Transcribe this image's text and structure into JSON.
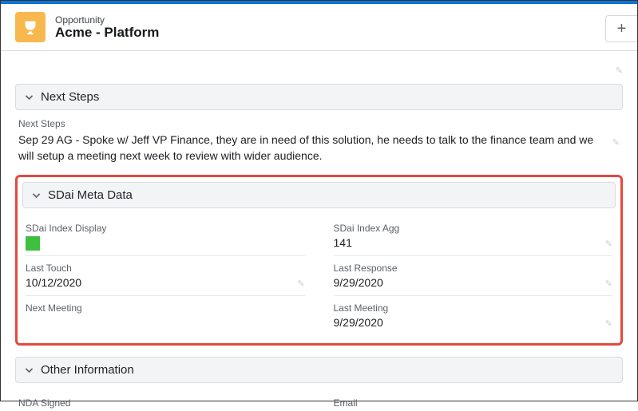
{
  "header": {
    "object_label": "Opportunity",
    "title": "Acme - Platform",
    "add_tooltip": "+"
  },
  "sections": {
    "next_steps": {
      "title": "Next Steps",
      "field_label": "Next Steps",
      "text": "Sep 29 AG - Spoke w/ Jeff VP Finance, they are in need of this solution, he needs to talk to the finance team and we will setup a meeting next week to review with wider audience."
    },
    "sdai": {
      "title": "SDai Meta Data",
      "fields": {
        "index_display": {
          "label": "SDai Index Display",
          "color": "#3fbf3f"
        },
        "index_agg": {
          "label": "SDai Index Agg",
          "value": "141"
        },
        "last_touch": {
          "label": "Last Touch",
          "value": "10/12/2020"
        },
        "last_response": {
          "label": "Last Response",
          "value": "9/29/2020"
        },
        "next_meeting": {
          "label": "Next Meeting",
          "value": ""
        },
        "last_meeting": {
          "label": "Last Meeting",
          "value": "9/29/2020"
        }
      }
    },
    "other": {
      "title": "Other Information",
      "fields": {
        "nda_signed": {
          "label": "NDA Signed"
        },
        "email": {
          "label": "Email"
        }
      }
    }
  }
}
